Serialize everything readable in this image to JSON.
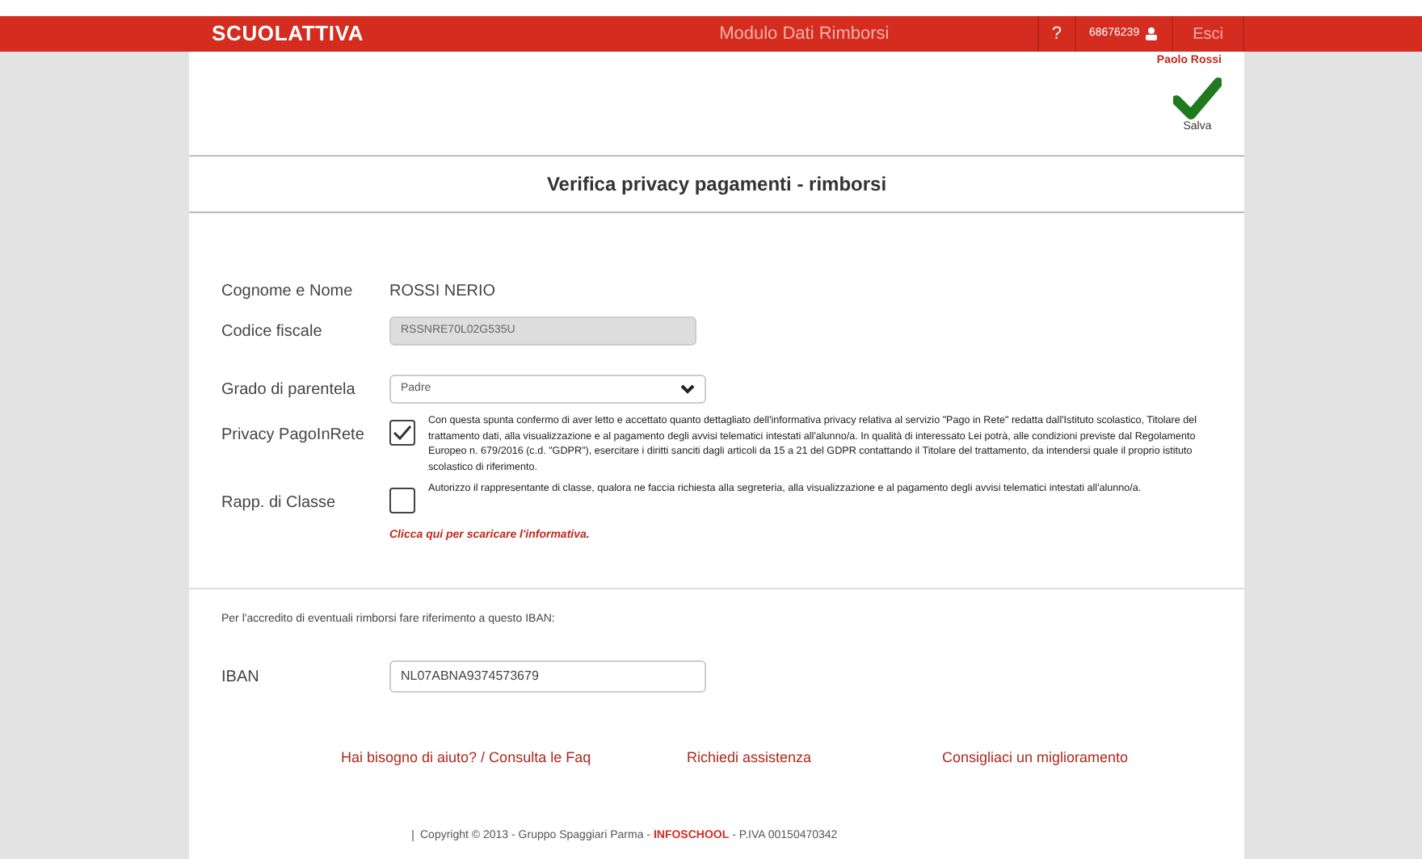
{
  "header": {
    "logo": "SCUOLATTIVA",
    "module_title": "Modulo Dati Rimborsi",
    "help": "?",
    "user_code": "68676239",
    "exit": "Esci"
  },
  "toolbar": {
    "user_name": "Paolo Rossi",
    "save_label": "Salva"
  },
  "form": {
    "title": "Verifica privacy pagamenti - rimborsi",
    "name_label": "Cognome e Nome",
    "name_value": "ROSSI NERIO",
    "tax_code_label": "Codice fiscale",
    "tax_code_value": "RSSNRE70L02G535U",
    "relation_label": "Grado di parentela",
    "relation_value": "Padre",
    "consents": [
      {
        "label": "Privacy PagoInRete",
        "checked": true,
        "text": "Con questa spunta confermo di aver letto e accettato quanto dettagliato dell'informativa privacy relativa al servizio \"Pago in Rete\" redatta dall'Istituto scolastico, Titolare del trattamento dati, alla visualizzazione e al pagamento degli avvisi telematici intestati all'alunno/a. In qualità di interessato Lei potrà, alle condizioni previste dal Regolamento Europeo n. 679/2016 (c.d. \"GDPR\"), esercitare i diritti sanciti dagli articoli da 15 a 21 del GDPR contattando il Titolare del trattamento, da intendersi quale il proprio istituto scolastico di riferimento."
      },
      {
        "label": "Rapp. di Classe",
        "checked": false,
        "text": "Autorizzo il rappresentante di classe, qualora ne faccia richiesta alla segreteria, alla visualizzazione e al pagamento degli avvisi telematici intestati all'alunno/a."
      }
    ],
    "download_link": "Clicca qui per scaricare l'informativa.",
    "iban_note": "Per l'accredito di eventuali rimborsi fare riferimento a questo IBAN:",
    "iban_label": "IBAN",
    "iban_value": "NL07ABNA9374573679"
  },
  "links": [
    "Hai bisogno di aiuto? / Consulta le Faq",
    "Richiedi assistenza",
    "Consigliaci un miglioramento"
  ],
  "footer": {
    "before": "Copyright © 2013 - Gruppo Spaggiari Parma - ",
    "brand": "INFOSCHOOL",
    "after": " - P.IVA 00150470342"
  }
}
